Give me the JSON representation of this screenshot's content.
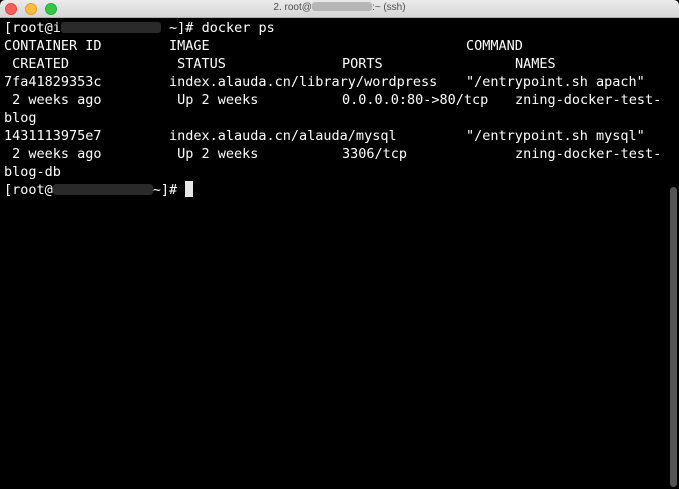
{
  "window": {
    "title_prefix": "2. root@",
    "title_suffix": ":~ (ssh)"
  },
  "terminal": {
    "prompt_prefix": "[root@i",
    "prompt_suffix": "~]# ",
    "command": "docker ps",
    "headers_row1": {
      "container_id": "CONTAINER ID",
      "image": "IMAGE",
      "command": "COMMAND"
    },
    "headers_row2": {
      "created": " CREATED",
      "status": " STATUS",
      "ports": "PORTS",
      "names": "NAMES"
    },
    "containers": [
      {
        "id": "7fa41829353c",
        "image": "index.alauda.cn/library/wordpress",
        "command": "\"/entrypoint.sh apach\"",
        "created": " 2 weeks ago",
        "status": " Up 2 weeks",
        "ports": "0.0.0.0:80->80/tcp",
        "names": "zning-docker-test-",
        "names_wrap": "blog"
      },
      {
        "id": "1431113975e7",
        "image": "index.alauda.cn/alauda/mysql",
        "command": "\"/entrypoint.sh mysql\"",
        "created": " 2 weeks ago",
        "status": " Up 2 weeks",
        "ports": "3306/tcp",
        "names": "zning-docker-test-",
        "names_wrap": "blog-db"
      }
    ],
    "final_prompt_prefix": "[root@",
    "final_prompt_suffix": "~]# "
  }
}
